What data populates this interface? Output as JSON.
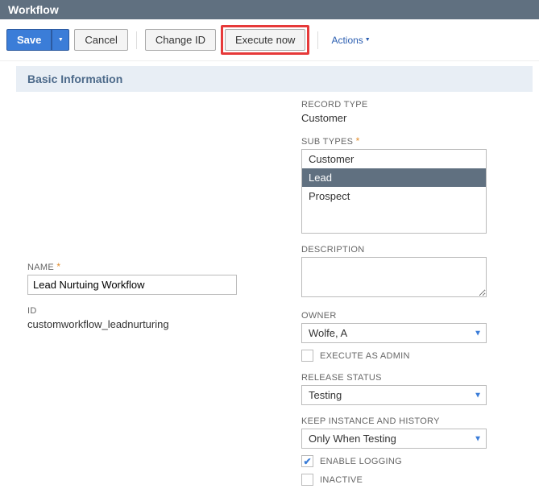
{
  "header": {
    "title": "Workflow"
  },
  "toolbar": {
    "save": "Save",
    "cancel": "Cancel",
    "change_id": "Change ID",
    "execute_now": "Execute now",
    "actions": "Actions"
  },
  "section": {
    "basic_info": "Basic Information"
  },
  "left": {
    "name_label": "NAME",
    "name_value": "Lead Nurtuing Workflow",
    "id_label": "ID",
    "id_value": "customworkflow_leadnurturing"
  },
  "right": {
    "record_type_label": "RECORD TYPE",
    "record_type_value": "Customer",
    "sub_types_label": "SUB TYPES",
    "sub_types": [
      "Customer",
      "Lead",
      "Prospect"
    ],
    "sub_types_selected": "Lead",
    "description_label": "DESCRIPTION",
    "description_value": "",
    "owner_label": "OWNER",
    "owner_value": "Wolfe, A",
    "execute_admin_label": "EXECUTE AS ADMIN",
    "execute_admin_checked": false,
    "release_status_label": "RELEASE STATUS",
    "release_status_value": "Testing",
    "keep_instance_label": "KEEP INSTANCE AND HISTORY",
    "keep_instance_value": "Only When Testing",
    "enable_logging_label": "ENABLE LOGGING",
    "enable_logging_checked": true,
    "inactive_label": "INACTIVE",
    "inactive_checked": false
  }
}
